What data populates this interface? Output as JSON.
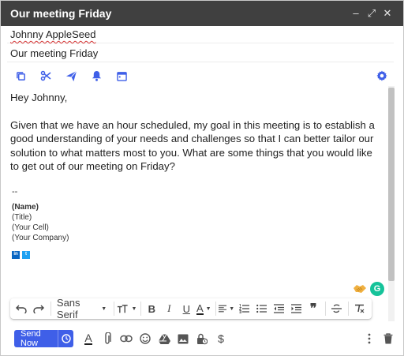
{
  "window": {
    "title": "Our meeting Friday",
    "controls": {
      "minimize": "–",
      "popout": "⤢",
      "close": "✕"
    }
  },
  "to": {
    "value": "Johnny AppleSeed"
  },
  "subject": {
    "value": "Our meeting Friday"
  },
  "top_tools": {
    "icons": [
      "copy-icon",
      "scissors-icon",
      "send-later-icon",
      "bell-icon",
      "calendar-icon"
    ],
    "settings_icon": "gear-icon",
    "accent_color": "#3f5fe8"
  },
  "body": {
    "greeting": "Hey Johnny,",
    "paragraph": "Given that we have an hour scheduled, my goal in this meeting is to establish a good understanding of your needs and challenges so that I can better tailor our solution to what matters most to you. What are some things that you would like to get out of our meeting on Friday?",
    "signature": {
      "dash": "--",
      "name": "(Name)",
      "title": "(Title)",
      "cell": "(Your Cell)",
      "company": "(Your Company)",
      "linkedin": "in",
      "twitter": "t"
    }
  },
  "floating": {
    "handshake_icon": "handshake-icon",
    "grammarly_letter": "G",
    "grammarly_color": "#15c39a"
  },
  "format_toolbar": {
    "font": "Sans Serif",
    "icons": [
      "undo-icon",
      "redo-icon",
      "text-size-icon",
      "bold-icon",
      "italic-icon",
      "underline-icon",
      "text-color-icon",
      "align-icon",
      "numbered-list-icon",
      "bulleted-list-icon",
      "indent-less-icon",
      "indent-more-icon",
      "quote-icon",
      "strikethrough-icon",
      "remove-formatting-icon"
    ],
    "labels": {
      "bold": "B",
      "italic": "I",
      "underline": "U",
      "text_color": "A",
      "quote": "❞"
    }
  },
  "bottom_bar": {
    "send_label": "Send Now",
    "send_color": "#3f5fe8",
    "format_letter": "A"
  }
}
